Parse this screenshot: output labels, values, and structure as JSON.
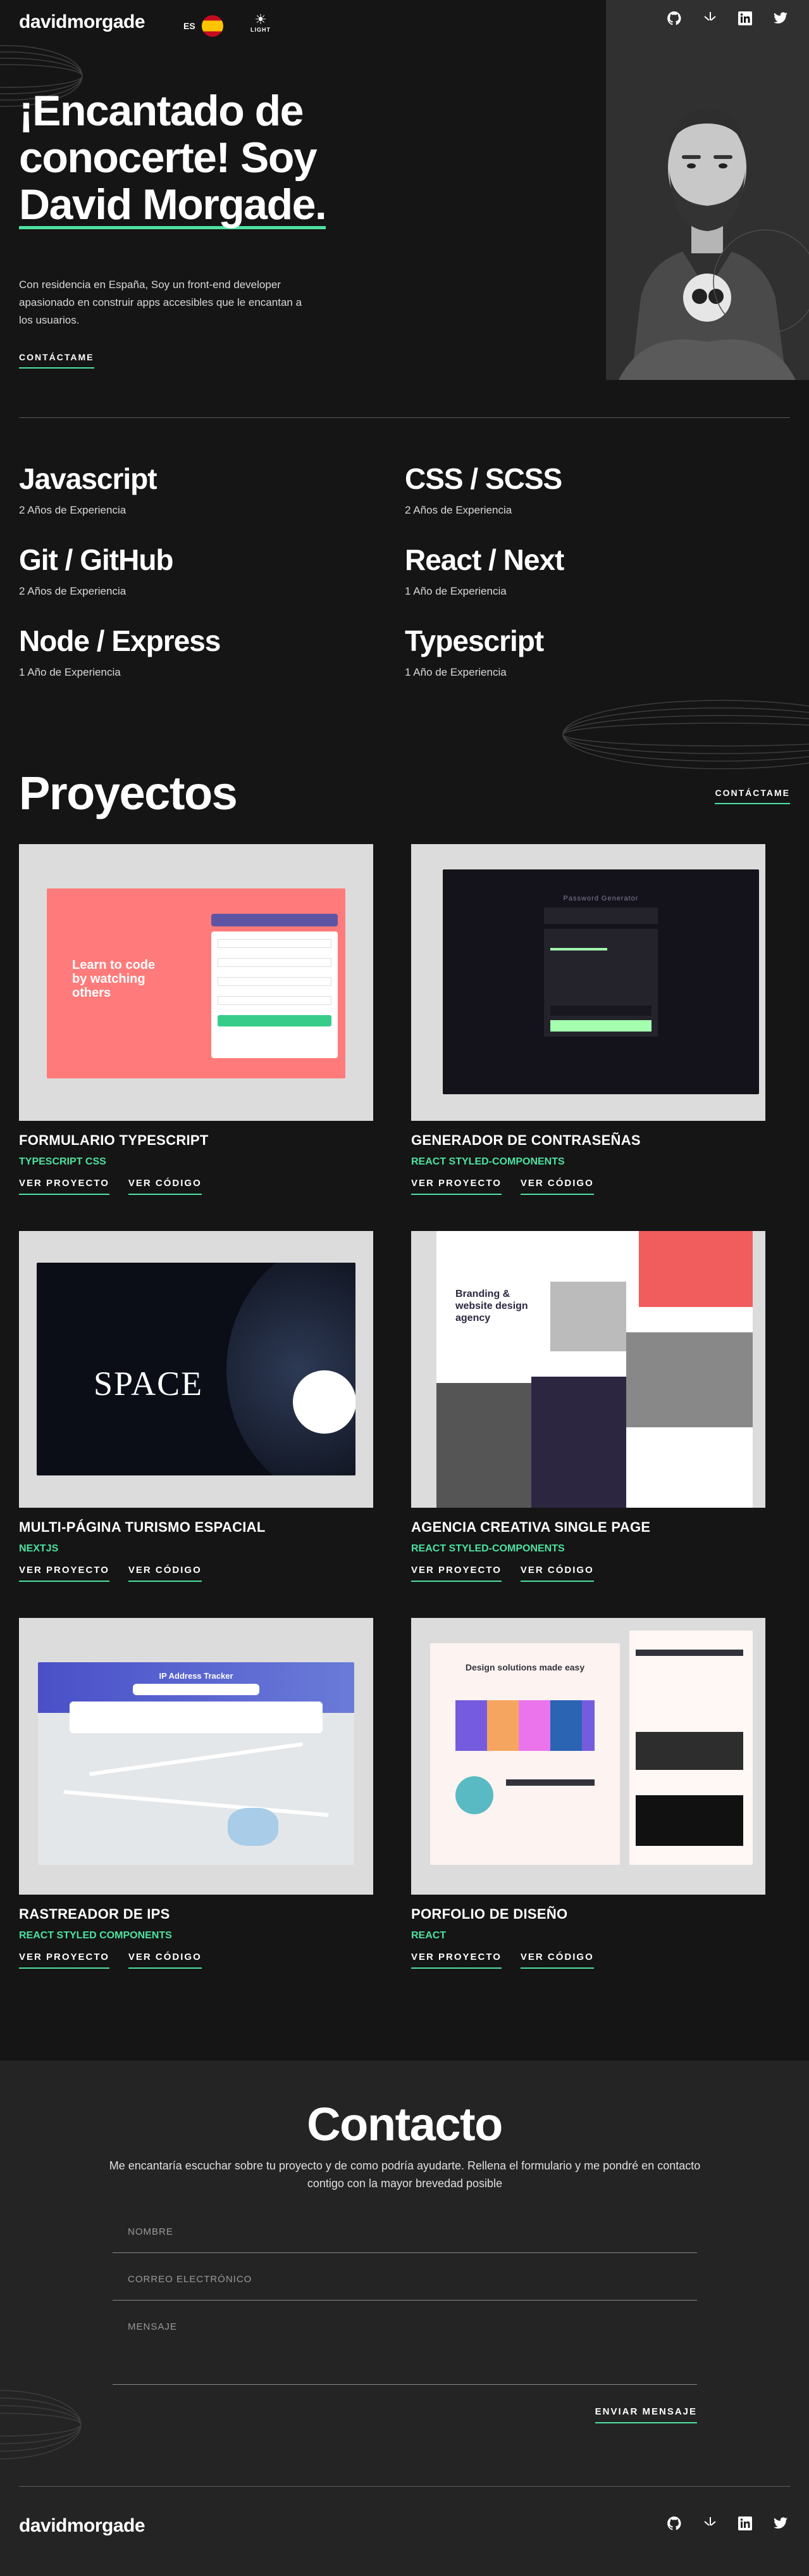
{
  "header": {
    "logo": "davidmorgade",
    "lang_code": "ES",
    "theme_label": "LIGHT",
    "socials": [
      "github-icon",
      "frontend-mentor-icon",
      "linkedin-icon",
      "twitter-icon"
    ]
  },
  "hero": {
    "title_line1": "¡Encantado de",
    "title_line2": "conocerte! Soy",
    "title_line3": "David Morgade.",
    "description": "Con residencia en España, Soy un front-end developer apasionado en construir apps accesibles que le encantan a los usuarios.",
    "cta": "CONTÁCTAME"
  },
  "skills": [
    {
      "name": "Javascript",
      "experience": "2 Años de Experiencia"
    },
    {
      "name": "CSS / SCSS",
      "experience": "2 Años de Experiencia"
    },
    {
      "name": "Git / GitHub",
      "experience": "2 Años de Experiencia"
    },
    {
      "name": "React / Next",
      "experience": "1 Año de Experiencia"
    },
    {
      "name": "Node / Express",
      "experience": "1 Año de Experiencia"
    },
    {
      "name": "Typescript",
      "experience": "1 Año de Experiencia"
    }
  ],
  "projects": {
    "title": "Proyectos",
    "cta": "CONTÁCTAME",
    "view_label": "VER PROYECTO",
    "code_label": "VER CÓDIGO",
    "items": [
      {
        "name": "FORMULARIO TYPESCRIPT",
        "tech": "TYPESCRIPT CSS",
        "thumb": "Learn to code by watching others"
      },
      {
        "name": "GENERADOR DE CONTRASEÑAS",
        "tech": "REACT STYLED-COMPONENTS",
        "thumb": "Password Generator"
      },
      {
        "name": "MULTI-PÁGINA TURISMO ESPACIAL",
        "tech": "NEXTJS",
        "thumb": "SPACE"
      },
      {
        "name": "AGENCIA CREATIVA SINGLE PAGE",
        "tech": "REACT STYLED-COMPONENTS",
        "thumb": "Branding & website design agency"
      },
      {
        "name": "RASTREADOR DE IPS",
        "tech": "REACT STYLED COMPONENTS",
        "thumb": "IP Address Tracker"
      },
      {
        "name": "PORFOLIO DE DISEÑO",
        "tech": "REACT",
        "thumb": "Design solutions made easy"
      }
    ]
  },
  "contact": {
    "title": "Contacto",
    "description": "Me encantaría escuchar sobre tu proyecto y de como podría ayudarte. Rellena el formulario y me pondré en contacto contigo con la mayor brevedad posible",
    "name_placeholder": "NOMBRE",
    "email_placeholder": "CORREO ELECTRÓNICO",
    "message_placeholder": "MENSAJE",
    "send": "ENVIAR MENSAJE"
  },
  "footer": {
    "logo": "davidmorgade"
  },
  "colors": {
    "accent": "#4ee1a0",
    "background": "#151515",
    "contact_bg": "#242424"
  }
}
